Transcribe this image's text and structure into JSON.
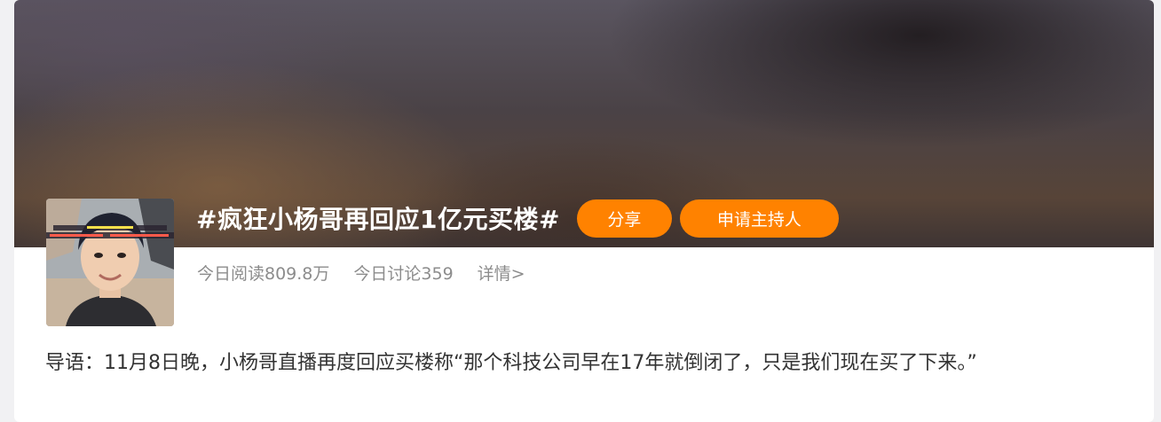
{
  "topic": {
    "title": "#疯狂小杨哥再回应1亿元买楼#",
    "share_label": "分享",
    "apply_host_label": "申请主持人"
  },
  "stats": {
    "reads": "今日阅读809.8万",
    "discussions": "今日讨论359",
    "details_link": "详情>"
  },
  "intro": {
    "text": "导语：11月8日晚，小杨哥直播再度回应买楼称“那个科技公司早在17年就倒闭了，只是我们现在买了下来。”"
  },
  "colors": {
    "accent": "#ff8200",
    "muted_text": "#8c8c8c",
    "body_text": "#333333"
  }
}
